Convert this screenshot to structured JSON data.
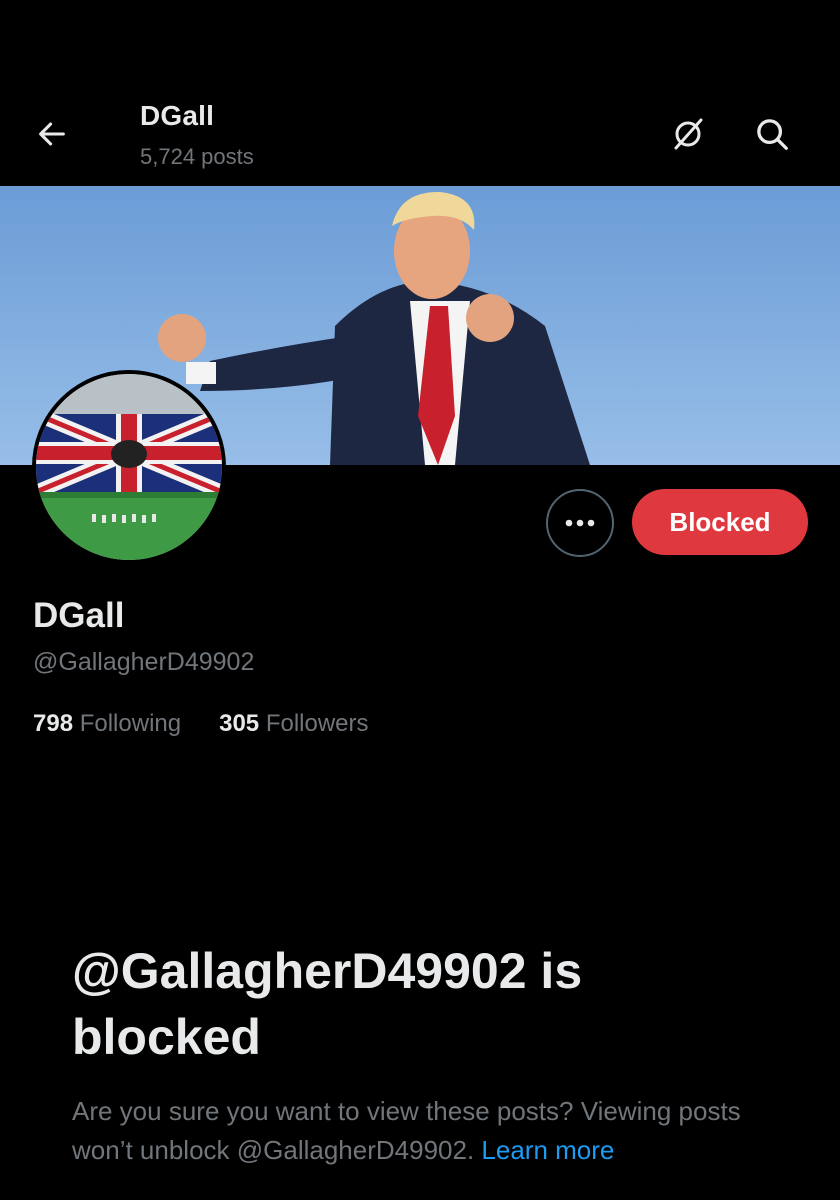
{
  "header": {
    "title": "DGall",
    "post_count": "5,724 posts",
    "back_icon": "arrow-left-icon",
    "grok_icon": "grok-icon",
    "search_icon": "search-icon"
  },
  "banner": {
    "description_icon": "banner-photo"
  },
  "avatar": {
    "icon": "avatar-stadium-flag"
  },
  "actions": {
    "more_icon": "more-dots-icon",
    "blocked_label": "Blocked"
  },
  "profile": {
    "display_name": "DGall",
    "handle": "@GallagherD49902",
    "following_count": "798",
    "following_label": "Following",
    "followers_count": "305",
    "followers_label": "Followers"
  },
  "blocked_notice": {
    "title": "@GallagherD49902 is blocked",
    "description": "Are you sure you want to view these posts? Viewing posts won’t unblock @GallagherD49902.",
    "learn_more": "Learn more"
  },
  "colors": {
    "background": "#000000",
    "primary_text": "#e7e9ea",
    "secondary_text": "#71767b",
    "blocked_red": "#e0383f",
    "link_blue": "#1d9bf0"
  }
}
